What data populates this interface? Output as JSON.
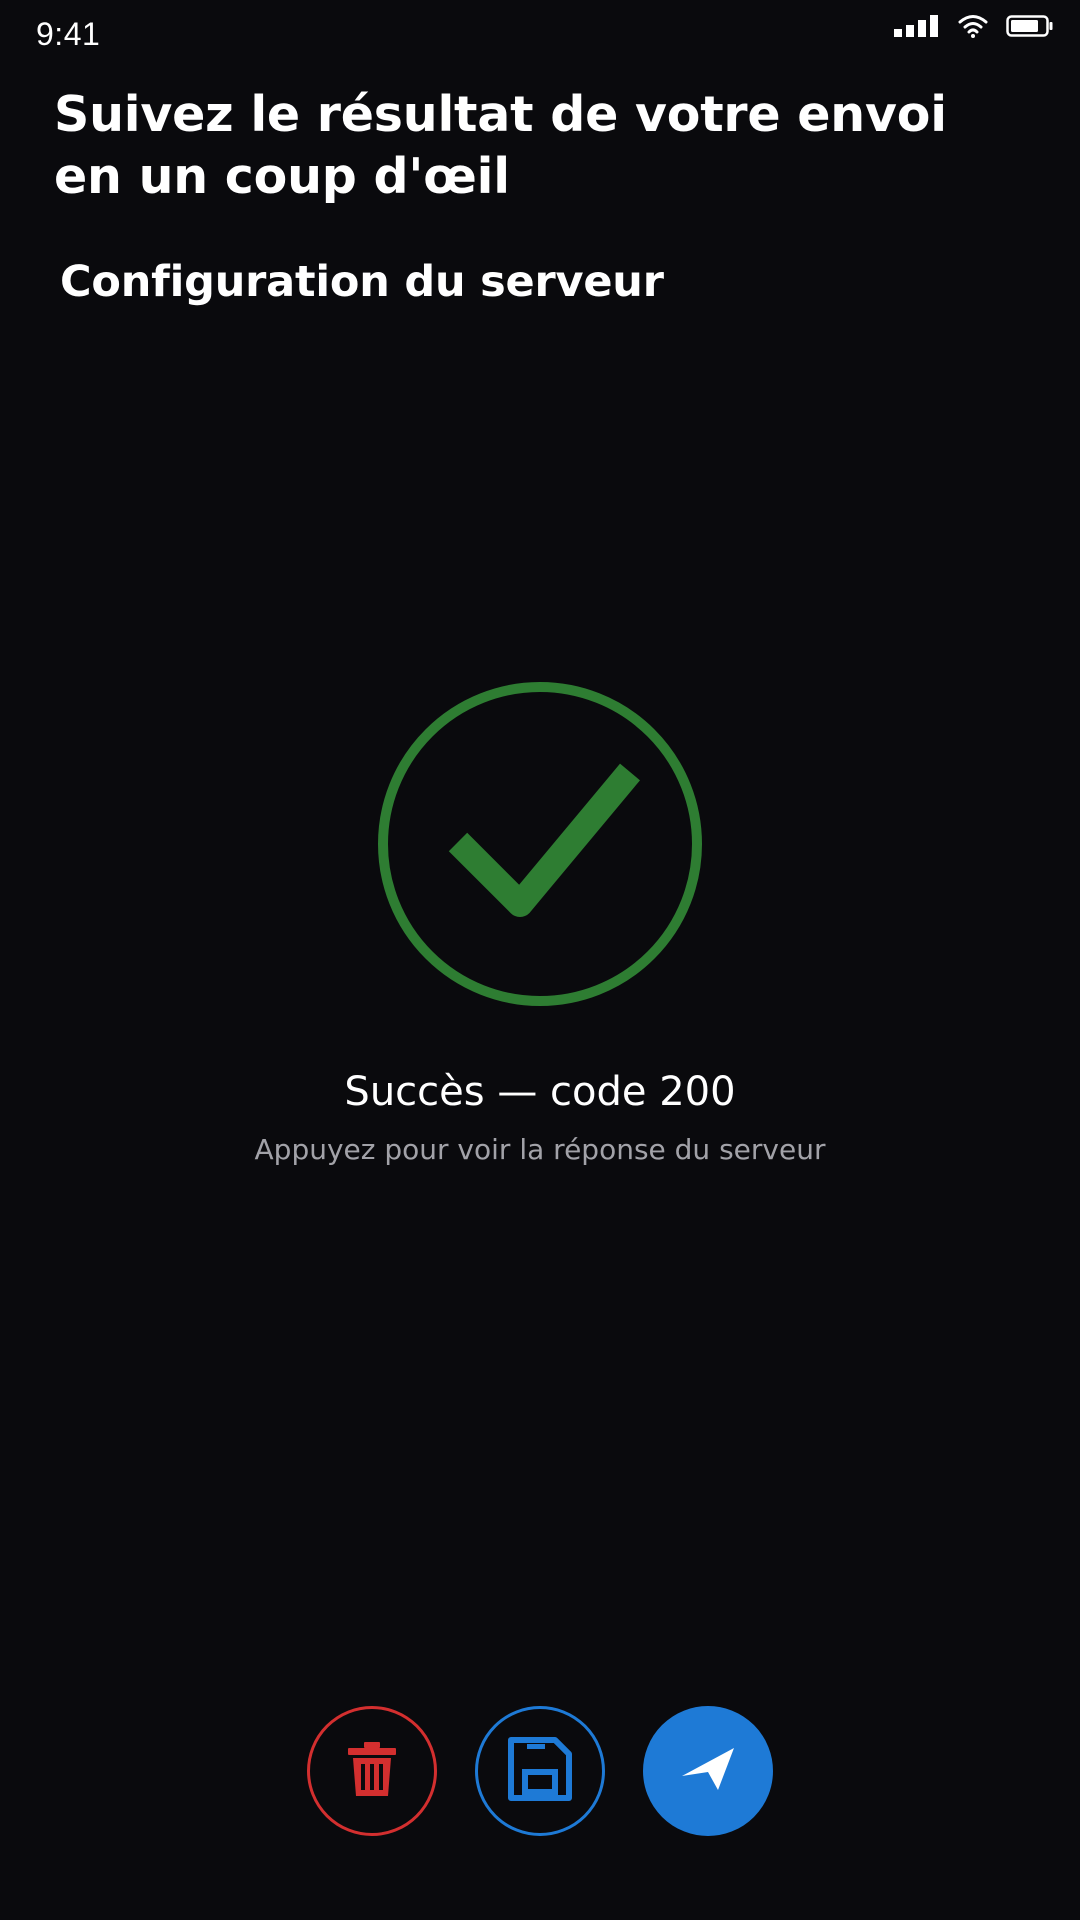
{
  "status_bar": {
    "time": "9:41",
    "icons": [
      "signal-icon",
      "wifi-icon",
      "battery-icon"
    ]
  },
  "header": {
    "title": "Suivez le résultat de votre envoi en un coup d'œil",
    "subtitle": "Configuration du serveur"
  },
  "result": {
    "status_icon": "check-circle-icon",
    "status_color": "#2e7d32",
    "title": "Succès — code 200",
    "hint": "Appuyez pour voir la réponse du serveur"
  },
  "actions": {
    "delete": {
      "icon": "trash-icon",
      "color": "#d32f2f"
    },
    "save": {
      "icon": "floppy-disk-icon",
      "color": "#1e7ad6"
    },
    "send": {
      "icon": "send-icon",
      "color": "#1e7ad6"
    }
  },
  "colors": {
    "background": "#0a0a0d",
    "text_primary": "#ffffff",
    "text_secondary": "#a2a2a8"
  }
}
